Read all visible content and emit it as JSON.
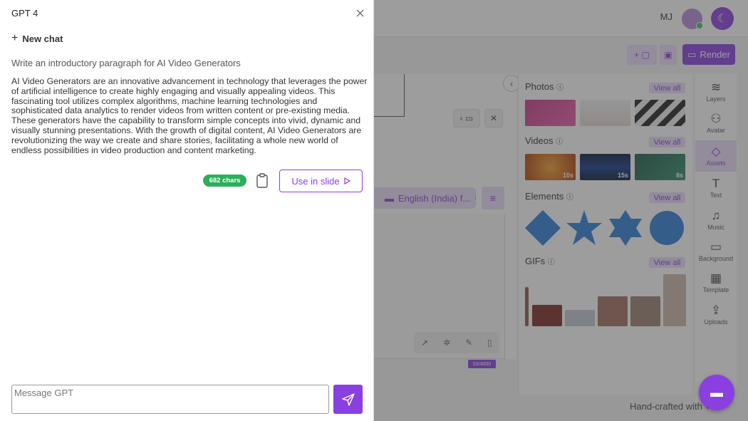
{
  "panel": {
    "title": "GPT 4",
    "new_chat_label": "New chat",
    "prompt": "Write an introductory paragraph for AI Video Generators",
    "response": "AI Video Generators are an innovative advancement in technology that leverages the power of artificial intelligence to create highly engaging and visually appealing videos. This fascinating tool utilizes complex algorithms, machine learning technologies and sophisticated data analytics to render videos from written content or pre-existing media. These generators have the capability to transform simple concepts into vivid, dynamic and visually stunning presentations. With the growth of digital content, AI Video Generators are revolutionizing the way we create and share stories, facilitating a whole new world of endless possibilities in video production and content marketing.",
    "chars_badge": "682 chars",
    "use_in_slide_label": "Use in slide",
    "message_placeholder": "Message GPT"
  },
  "topbar": {
    "initials": "MJ"
  },
  "toolbar": {
    "render_label": "Render"
  },
  "editor": {
    "language_label": "English (India) f...",
    "char_count": "53/4000"
  },
  "assets": {
    "photos_title": "Photos",
    "videos_title": "Videos",
    "elements_title": "Elements",
    "gifs_title": "GIFs",
    "view_all_label": "View all",
    "video_durations": [
      "10s",
      "15s",
      "8s"
    ]
  },
  "rail": {
    "items": [
      {
        "label": "Layers",
        "icon": "layers-icon"
      },
      {
        "label": "Avatar",
        "icon": "avatar-icon"
      },
      {
        "label": "Assets",
        "icon": "assets-icon"
      },
      {
        "label": "Text",
        "icon": "text-icon"
      },
      {
        "label": "Music",
        "icon": "music-icon"
      },
      {
        "label": "Background",
        "icon": "background-icon"
      },
      {
        "label": "Template",
        "icon": "template-icon"
      },
      {
        "label": "Uploads",
        "icon": "uploads-icon"
      }
    ]
  },
  "footer": {
    "text": "Hand-crafted with"
  },
  "colors": {
    "accent": "#8a3fe0",
    "accent_light": "#eadcf8",
    "badge_green": "#2cae5b",
    "shape_blue": "#2f7fd9"
  }
}
